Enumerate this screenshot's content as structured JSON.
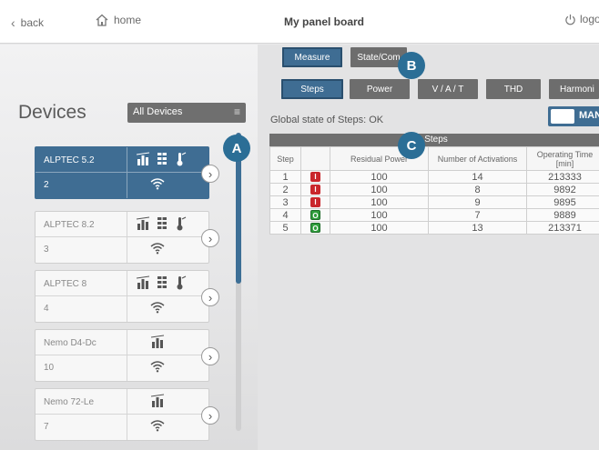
{
  "header": {
    "back_label": "back",
    "home_label": "home",
    "title": "My panel board",
    "logout_label": "logo"
  },
  "devices": {
    "title": "Devices",
    "filter_value": "All Devices",
    "list": [
      {
        "name": "ALPTEC 5.2",
        "number": "2",
        "active": true
      },
      {
        "name": "ALPTEC 8.2",
        "number": "3",
        "active": false
      },
      {
        "name": "ALPTEC 8",
        "number": "4",
        "active": false
      },
      {
        "name": "Nemo D4-Dc",
        "number": "10",
        "active": false
      },
      {
        "name": "Nemo 72-Le",
        "number": "7",
        "active": false
      }
    ]
  },
  "tabs_top": {
    "measure": "Measure",
    "state": "State/Com"
  },
  "tabs_sub": {
    "steps": "Steps",
    "power": "Power",
    "vat": "V / A / T",
    "thd": "THD",
    "harmonics": "Harmoni"
  },
  "global_state": "Global state of Steps: OK",
  "toggle_label": "MAN",
  "table": {
    "title": "Steps",
    "columns": [
      "Step",
      "",
      "Residual Power",
      "Number of Activations",
      "Operating Time [min]"
    ],
    "rows": [
      {
        "step": "1",
        "state": "I",
        "residual": "100",
        "activations": "14",
        "time": "213333"
      },
      {
        "step": "2",
        "state": "I",
        "residual": "100",
        "activations": "8",
        "time": "9892"
      },
      {
        "step": "3",
        "state": "I",
        "residual": "100",
        "activations": "9",
        "time": "9895"
      },
      {
        "step": "4",
        "state": "O",
        "residual": "100",
        "activations": "7",
        "time": "9889"
      },
      {
        "step": "5",
        "state": "O",
        "residual": "100",
        "activations": "13",
        "time": "213371"
      }
    ]
  },
  "badges": {
    "a": "A",
    "b": "B",
    "c": "C"
  },
  "colors": {
    "accent": "#3f6d93",
    "badge": "#2b6e96",
    "state_off": "#c9262c",
    "state_on": "#2f9d3c"
  }
}
